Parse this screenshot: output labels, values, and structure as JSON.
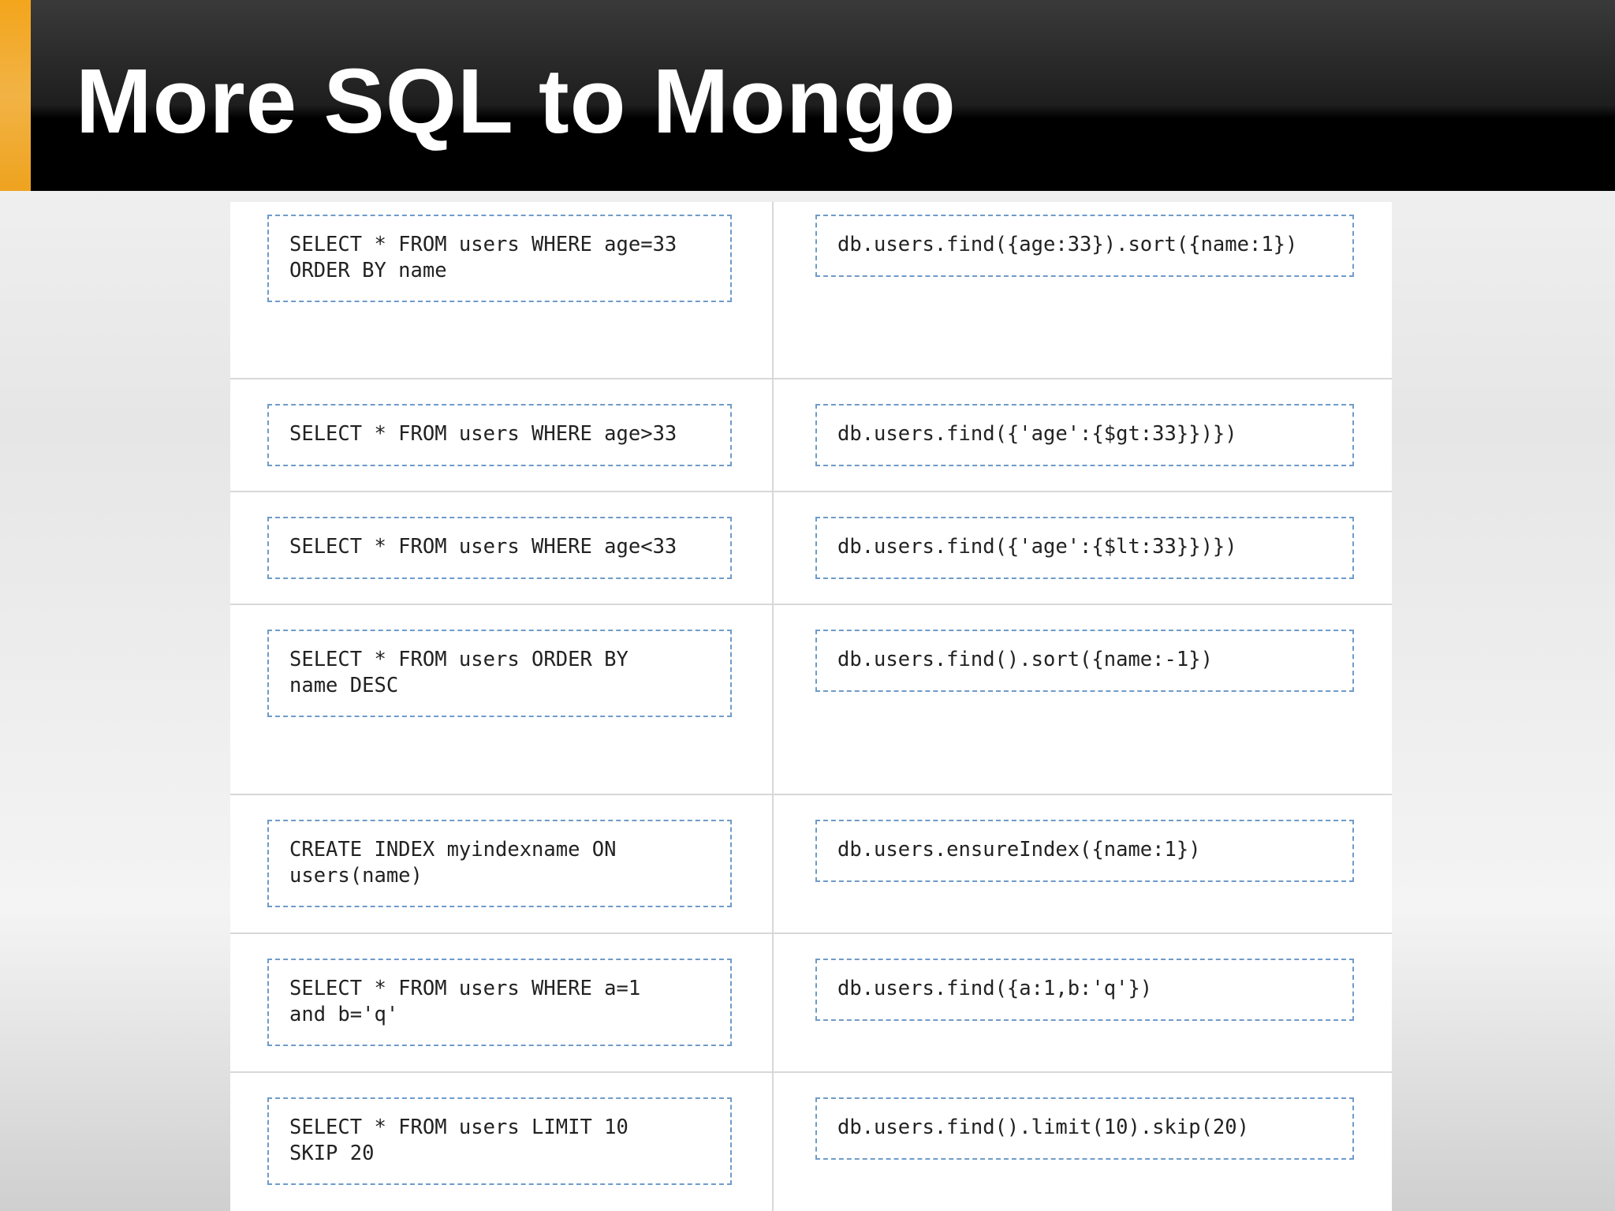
{
  "slide": {
    "title": "More SQL to Mongo"
  },
  "rows": [
    {
      "sql": "SELECT * FROM users WHERE age=33\nORDER BY name",
      "mongo": "db.users.find({age:33}).sort({name:1})"
    },
    {
      "sql": "SELECT * FROM users WHERE age>33",
      "mongo": "db.users.find({'age':{$gt:33}})})"
    },
    {
      "sql": "SELECT * FROM users WHERE age<33",
      "mongo": "db.users.find({'age':{$lt:33}})})"
    },
    {
      "sql": "SELECT * FROM users ORDER BY\nname DESC",
      "mongo": "db.users.find().sort({name:-1})"
    },
    {
      "sql": "CREATE INDEX myindexname ON\nusers(name)",
      "mongo": "db.users.ensureIndex({name:1})"
    },
    {
      "sql": "SELECT * FROM users WHERE a=1\nand b='q'",
      "mongo": "db.users.find({a:1,b:'q'})"
    },
    {
      "sql": "SELECT * FROM users LIMIT 10\nSKIP 20",
      "mongo": "db.users.find().limit(10).skip(20)"
    }
  ]
}
